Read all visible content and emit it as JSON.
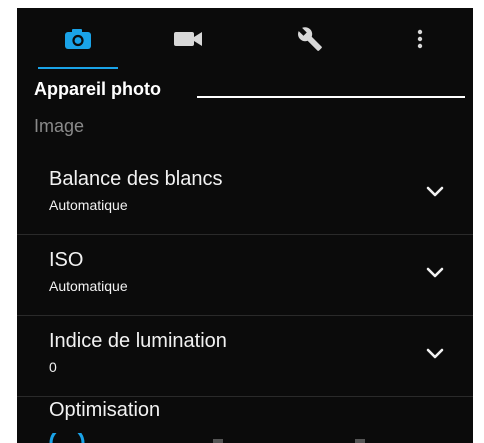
{
  "tabs": [
    {
      "icon": "camera-icon",
      "active": true
    },
    {
      "icon": "video-camera-icon",
      "active": false
    },
    {
      "icon": "wrench-icon",
      "active": false
    },
    {
      "icon": "more-vertical-icon",
      "active": false
    }
  ],
  "colors": {
    "background": "#0b0b0b",
    "accent": "#1aa3e8",
    "text": "#f2f2f2",
    "muted": "#8a8a8a",
    "icon_inactive": "#d8d8d8"
  },
  "section": {
    "title": "Appareil photo"
  },
  "category": {
    "label": "Image"
  },
  "settings": [
    {
      "label": "Balance des blancs",
      "value": "Automatique"
    },
    {
      "label": "ISO",
      "value": "Automatique"
    },
    {
      "label": "Indice de lumination",
      "value": "0"
    }
  ],
  "optimisation": {
    "label": "Optimisation"
  }
}
